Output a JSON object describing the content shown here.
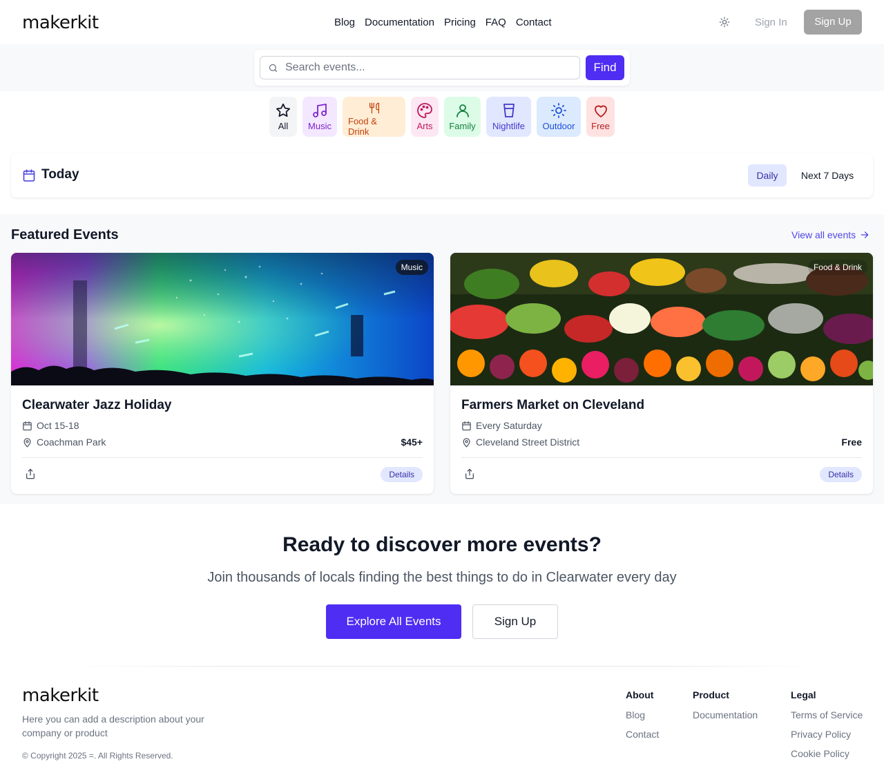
{
  "header": {
    "logo": "makerkit",
    "nav": [
      "Blog",
      "Documentation",
      "Pricing",
      "FAQ",
      "Contact"
    ],
    "theme_icon": "sun-icon",
    "sign_in": "Sign In",
    "sign_up": "Sign Up"
  },
  "search": {
    "placeholder": "Search events...",
    "value": "",
    "button": "Find"
  },
  "categories": [
    {
      "label": "All",
      "icon": "star-icon",
      "bg": "#f3f4f6",
      "color": "#111827"
    },
    {
      "label": "Music",
      "icon": "music-icon",
      "bg": "#f3e8ff",
      "color": "#7e22ce"
    },
    {
      "label": "Food & Drink",
      "icon": "utensils-icon",
      "bg": "#ffedd5",
      "color": "#c2410c"
    },
    {
      "label": "Arts",
      "icon": "palette-icon",
      "bg": "#fce7f3",
      "color": "#be185d"
    },
    {
      "label": "Family",
      "icon": "user-icon",
      "bg": "#dcfce7",
      "color": "#15803d"
    },
    {
      "label": "Nightlife",
      "icon": "glass-icon",
      "bg": "#e0e7ff",
      "color": "#4338ca"
    },
    {
      "label": "Outdoor",
      "icon": "sun-icon",
      "bg": "#dbeafe",
      "color": "#1d4ed8"
    },
    {
      "label": "Free",
      "icon": "heart-icon",
      "bg": "#fee2e2",
      "color": "#b91c1c"
    }
  ],
  "today": {
    "title": "Today",
    "tabs": [
      "Daily",
      "Next 7 Days"
    ],
    "active_tab": "Daily"
  },
  "featured": {
    "title": "Featured Events",
    "view_all": "View all events",
    "events": [
      {
        "title": "Clearwater Jazz Holiday",
        "category": "Music",
        "date": "Oct 15-18",
        "location": "Coachman Park",
        "price": "$45+",
        "details": "Details"
      },
      {
        "title": "Farmers Market on Cleveland",
        "category": "Food & Drink",
        "date": "Every Saturday",
        "location": "Cleveland Street District",
        "price": "Free",
        "details": "Details"
      }
    ]
  },
  "cta": {
    "title": "Ready to discover more events?",
    "subtitle": "Join thousands of locals finding the best things to do in Clearwater every day",
    "primary": "Explore All Events",
    "secondary": "Sign Up"
  },
  "footer": {
    "logo": "makerkit",
    "description": "Here you can add a description about your company or product",
    "copyright": "© Copyright 2025 =. All Rights Reserved.",
    "columns": [
      {
        "heading": "About",
        "links": [
          "Blog",
          "Contact"
        ]
      },
      {
        "heading": "Product",
        "links": [
          "Documentation"
        ]
      },
      {
        "heading": "Legal",
        "links": [
          "Terms of Service",
          "Privacy Policy",
          "Cookie Policy"
        ]
      }
    ]
  },
  "colors": {
    "brand": "#4f2df3",
    "accent_link": "#4f46e5",
    "muted_bg": "#f8f9fb"
  }
}
